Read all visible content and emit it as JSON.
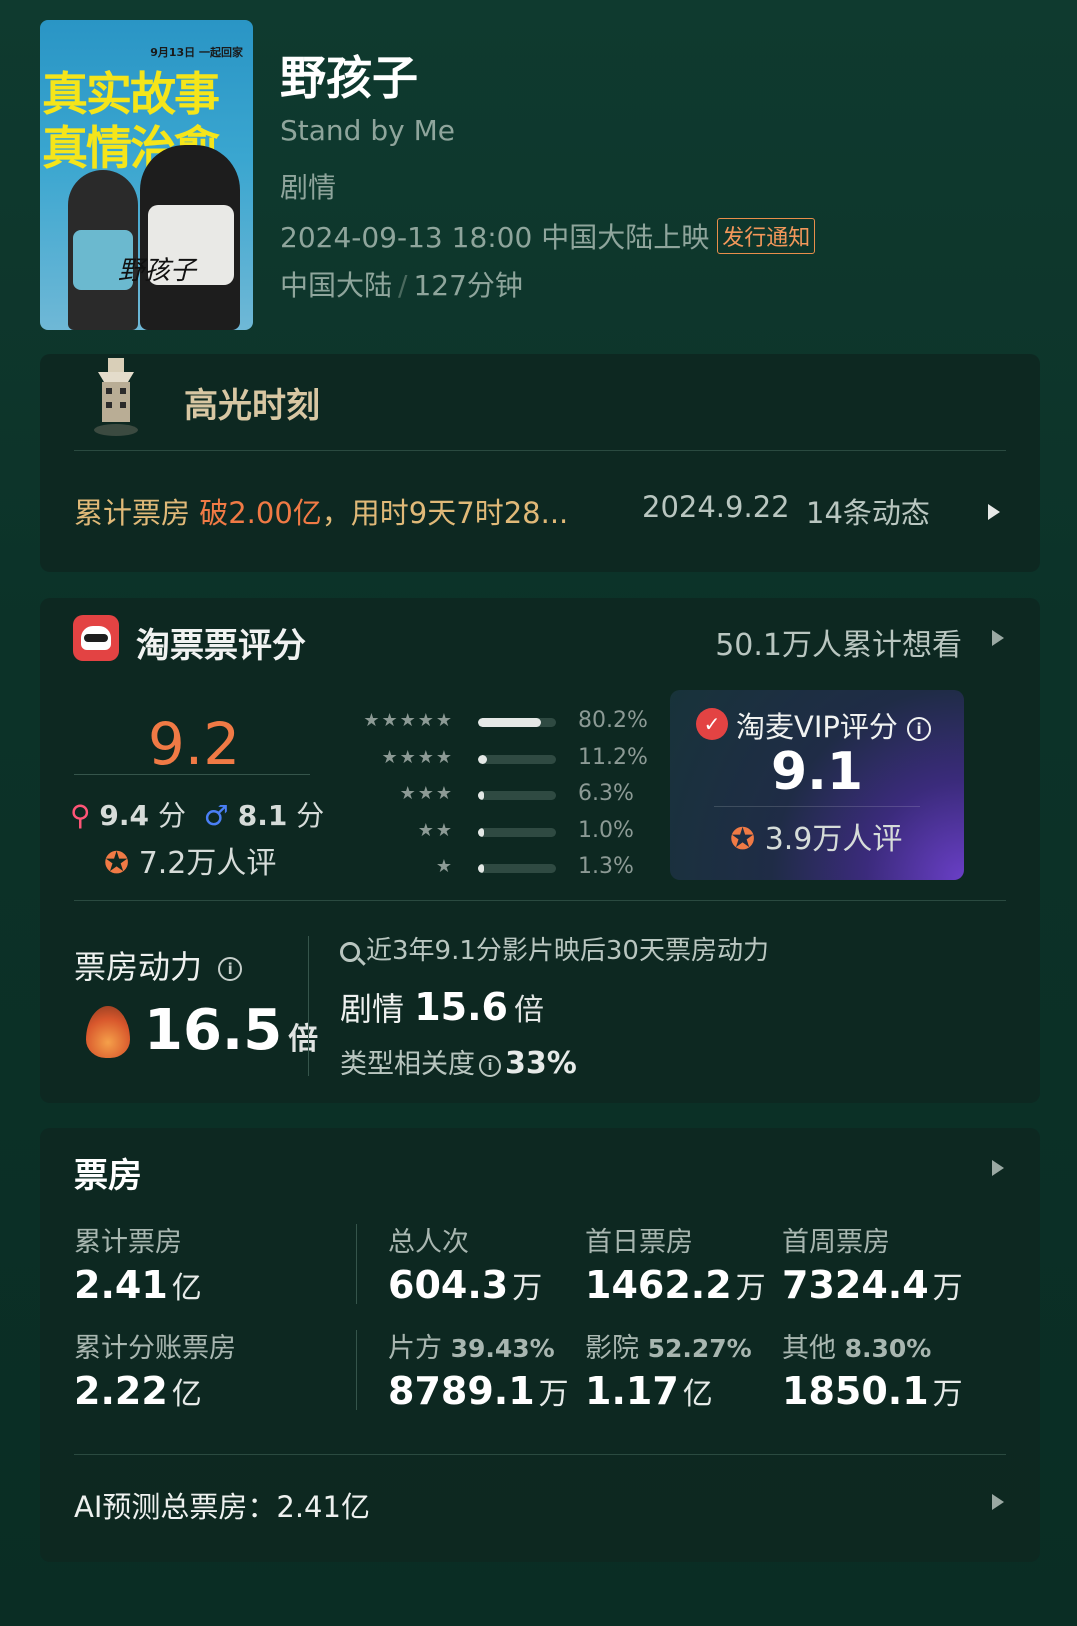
{
  "movie": {
    "poster": {
      "date_text": "9月13日 一起回家",
      "line1": "真实故事",
      "line2": "真情治愈",
      "signature": "野孩子"
    },
    "title": "野孩子",
    "subtitle": "Stand by Me",
    "genre": "剧情",
    "release": "2024-09-13 18:00 中国大陆上映",
    "release_notice": "发行通知",
    "region": "中国大陆",
    "separator": "/",
    "duration": "127分钟"
  },
  "highlight": {
    "title": "高光时刻",
    "prefix": "累计票房 ",
    "hot": "破2.00亿",
    "suffix": "，用时9天7时28...",
    "date": "2024.9.22",
    "count": "14条动态"
  },
  "rating": {
    "title": "淘票票评分",
    "want": "50.1万人累计想看",
    "score": "9.2",
    "female_score": "9.4",
    "male_score": "8.1",
    "score_unit": "分",
    "raters": "7.2万人评",
    "distribution": [
      {
        "stars": "★★★★★",
        "pct": "80.2%",
        "fraction": 0.802
      },
      {
        "stars": "★★★★",
        "pct": "11.2%",
        "fraction": 0.112
      },
      {
        "stars": "★★★",
        "pct": "6.3%",
        "fraction": 0.063
      },
      {
        "stars": "★★",
        "pct": "1.0%",
        "fraction": 0.01
      },
      {
        "stars": "★",
        "pct": "1.3%",
        "fraction": 0.013
      }
    ],
    "vip": {
      "title": "淘麦VIP评分",
      "score": "9.1",
      "raters": "3.9万人评"
    },
    "power": {
      "label": "票房动力",
      "value": "16.5",
      "unit": "倍",
      "ref": "近3年9.1分影片映后30天票房动力",
      "genre_label": "剧情",
      "genre_value": "15.6",
      "genre_unit": "倍",
      "relevance_label": "类型相关度",
      "relevance_value": "33%"
    }
  },
  "boxoffice": {
    "title": "票房",
    "stats_row1": [
      {
        "label": "累计票房",
        "value": "2.41",
        "unit": "亿"
      },
      {
        "label": "总人次",
        "value": "604.3",
        "unit": "万"
      },
      {
        "label": "首日票房",
        "value": "1462.2",
        "unit": "万"
      },
      {
        "label": "首周票房",
        "value": "7324.4",
        "unit": "万"
      }
    ],
    "stats_row2": [
      {
        "label": "累计分账票房",
        "pct": "",
        "value": "2.22",
        "unit": "亿"
      },
      {
        "label": "片方",
        "pct": "39.43%",
        "value": "8789.1",
        "unit": "万"
      },
      {
        "label": "影院",
        "pct": "52.27%",
        "value": "1.17",
        "unit": "亿"
      },
      {
        "label": "其他",
        "pct": "8.30%",
        "value": "1850.1",
        "unit": "万"
      }
    ],
    "ai_prediction": "AI预测总票房：2.41亿"
  },
  "colors": {
    "accent_orange": "#f07a45",
    "highlight_gold": "#e0b978",
    "background": "#0c3228"
  }
}
